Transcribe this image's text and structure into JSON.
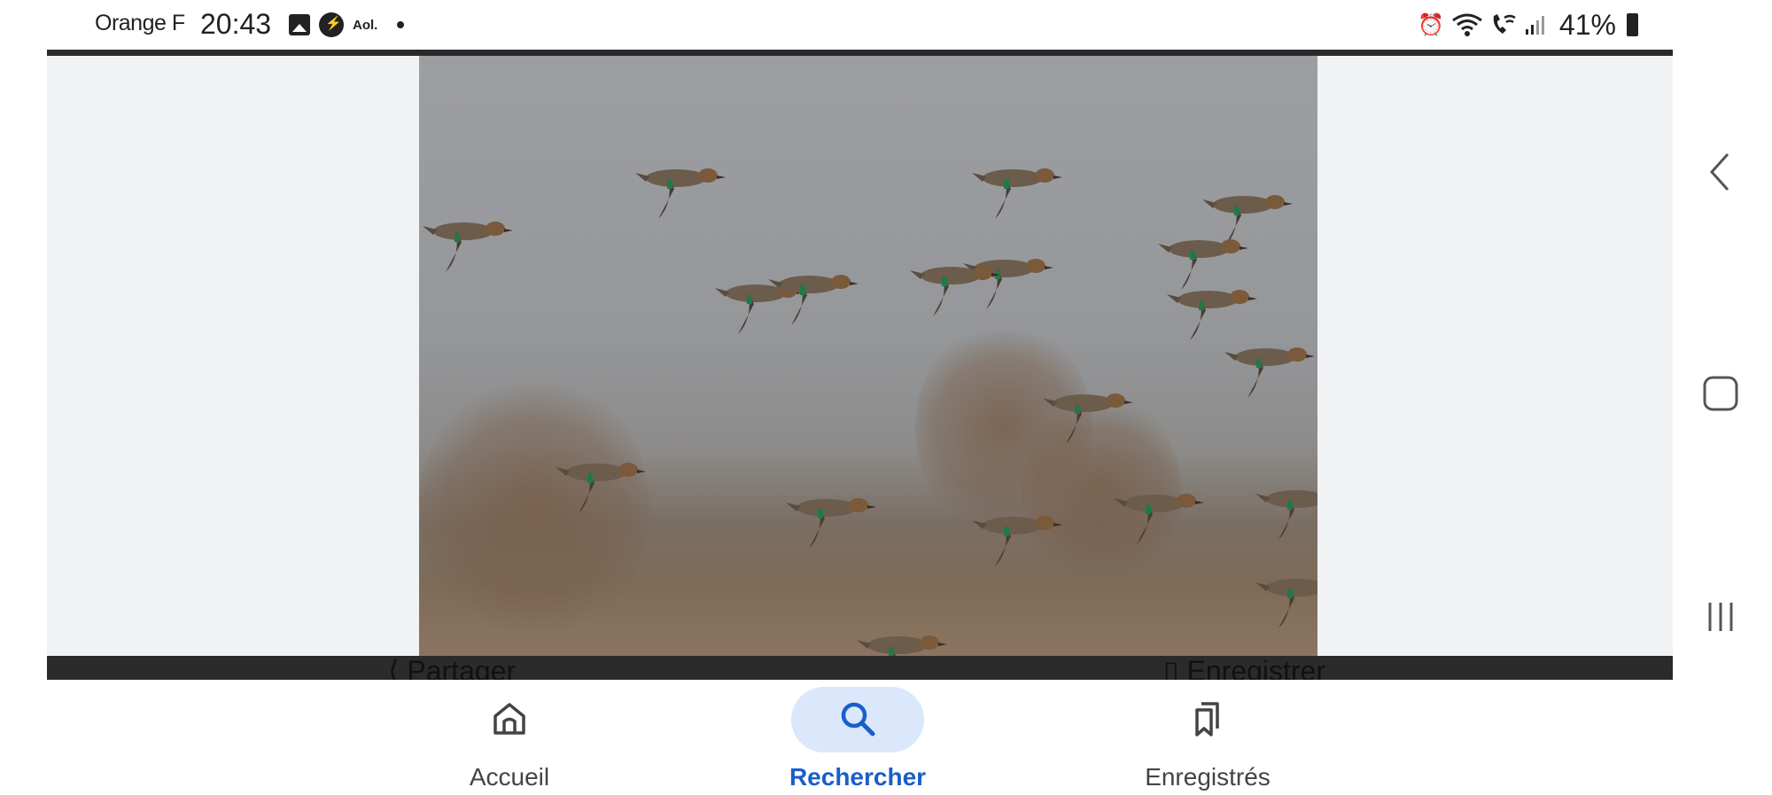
{
  "status_bar": {
    "carrier": "Orange F",
    "time": "20:43",
    "aol": "Aol.",
    "battery": "41%",
    "icons_left": [
      "gallery-icon",
      "messenger-icon",
      "aol-icon",
      "dot-icon"
    ],
    "icons_right": [
      "alarm-icon",
      "wifi-icon",
      "wifi-calling-icon",
      "signal-icon",
      "battery-icon"
    ]
  },
  "viewer": {
    "image_alt": "",
    "actions": {
      "share_label": "Partager",
      "save_label": "Enregistrer"
    }
  },
  "bottom_nav": {
    "items": [
      {
        "label": "Accueil",
        "icon": "home-icon",
        "active": false
      },
      {
        "label": "Rechercher",
        "icon": "search-icon",
        "active": true
      },
      {
        "label": "Enregistrés",
        "icon": "bookmarks-icon",
        "active": false
      }
    ],
    "active_color": "#1a5fc9",
    "active_pill_color": "#dbe7fb"
  },
  "system_nav": [
    "back-icon",
    "home-button-icon",
    "recents-icon"
  ]
}
